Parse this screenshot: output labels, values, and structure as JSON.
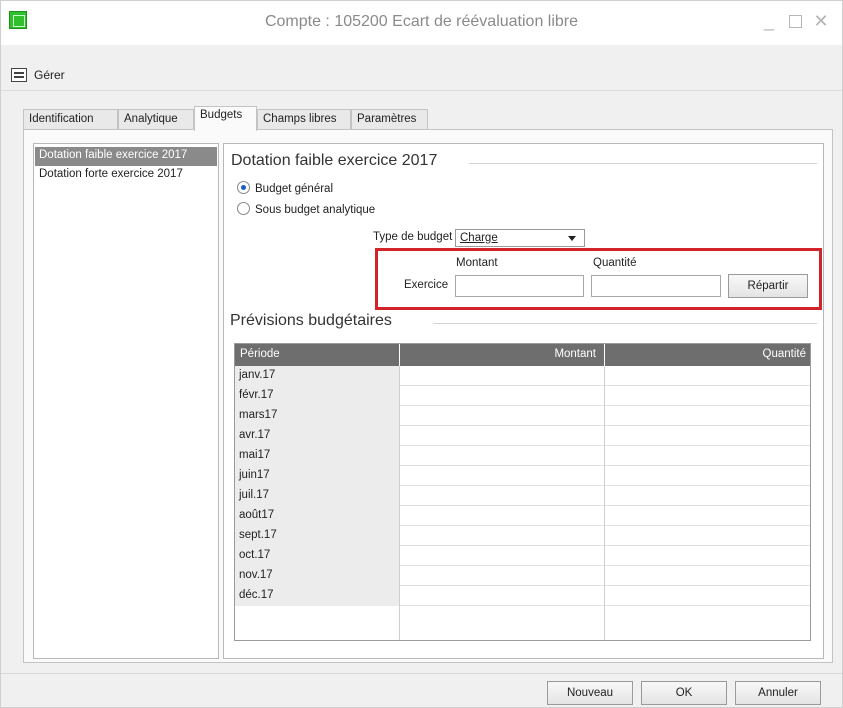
{
  "window": {
    "title": "Compte : 105200 Ecart de réévaluation libre",
    "minimize": "_",
    "close": "✕"
  },
  "menu": {
    "gerer": "Gérer"
  },
  "tabs": [
    {
      "label": "Identification",
      "active": false
    },
    {
      "label": "Analytique",
      "active": false
    },
    {
      "label": "Budgets",
      "active": true
    },
    {
      "label": "Champs libres",
      "active": false
    },
    {
      "label": "Paramètres",
      "active": false
    }
  ],
  "budget_list": [
    {
      "label": "Dotation faible exercice 2017",
      "selected": true
    },
    {
      "label": "Dotation forte exercice 2017",
      "selected": false
    }
  ],
  "detail": {
    "group_title": "Dotation faible exercice 2017",
    "radio_general": "Budget général",
    "radio_general_checked": true,
    "radio_analytique": "Sous budget analytique",
    "radio_analytique_checked": false,
    "type_label": "Type de budget",
    "type_value": "Charge",
    "col_montant": "Montant",
    "col_quantite": "Quantité",
    "exercice_label": "Exercice",
    "montant_value": "",
    "quantite_value": "",
    "repartir": "Répartir"
  },
  "previsions": {
    "title": "Prévisions budgétaires",
    "headers": [
      "Période",
      "Montant",
      "Quantité"
    ],
    "rows": [
      {
        "periode": "janv.17",
        "montant": "",
        "quantite": ""
      },
      {
        "periode": "févr.17",
        "montant": "",
        "quantite": ""
      },
      {
        "periode": "mars17",
        "montant": "",
        "quantite": ""
      },
      {
        "periode": "avr.17",
        "montant": "",
        "quantite": ""
      },
      {
        "periode": "mai17",
        "montant": "",
        "quantite": ""
      },
      {
        "periode": "juin17",
        "montant": "",
        "quantite": ""
      },
      {
        "periode": "juil.17",
        "montant": "",
        "quantite": ""
      },
      {
        "periode": "août17",
        "montant": "",
        "quantite": ""
      },
      {
        "periode": "sept.17",
        "montant": "",
        "quantite": ""
      },
      {
        "periode": "oct.17",
        "montant": "",
        "quantite": ""
      },
      {
        "periode": "nov.17",
        "montant": "",
        "quantite": ""
      },
      {
        "periode": "déc.17",
        "montant": "",
        "quantite": ""
      }
    ]
  },
  "buttons": {
    "nouveau": "Nouveau",
    "ok": "OK",
    "annuler": "Annuler"
  },
  "colors": {
    "highlight": "#d2232a",
    "selection": "#8a8a8a",
    "grid_header": "#6e6e6e",
    "radio_dot": "#1a5fbf"
  }
}
